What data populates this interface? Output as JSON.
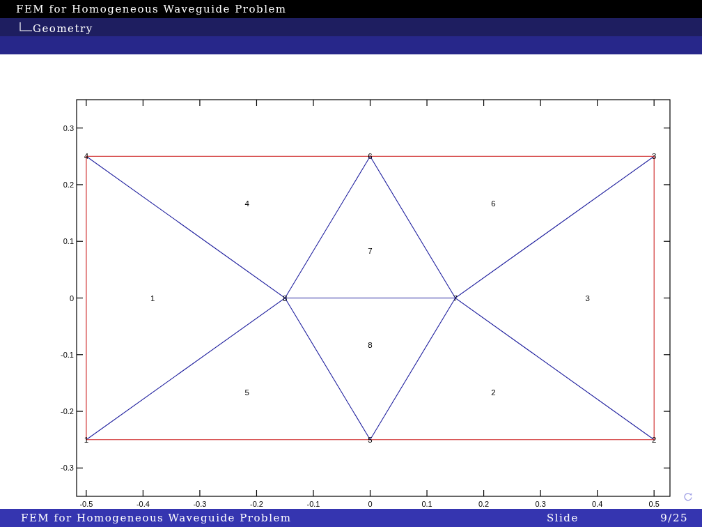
{
  "header": {
    "title": "FEM for Homogeneous Waveguide Problem",
    "section": "Geometry"
  },
  "figure": {
    "chart_data": {
      "type": "line",
      "xlim": [
        -0.517,
        0.528
      ],
      "ylim": [
        -0.35,
        0.35
      ],
      "xticks": [
        -0.5,
        -0.4,
        -0.3,
        -0.2,
        -0.1,
        0,
        0.1,
        0.2,
        0.3,
        0.4,
        0.5
      ],
      "yticks": [
        -0.3,
        -0.2,
        -0.1,
        0,
        0.1,
        0.2,
        0.3
      ],
      "series": [
        {
          "color": "#1f1f9e",
          "x": [
            -0.5,
            -0.15,
            0,
            0.15,
            0.5
          ],
          "values": [
            0.25,
            0,
            0.25,
            0,
            0.25
          ]
        },
        {
          "color": "#1f1f9e",
          "x": [
            -0.15,
            0.15
          ],
          "values": [
            0,
            0
          ]
        },
        {
          "color": "#1f1f9e",
          "x": [
            -0.5,
            -0.15,
            0,
            0.15,
            0.5
          ],
          "values": [
            -0.25,
            0,
            -0.25,
            0,
            -0.25
          ]
        },
        {
          "color": "#cc1f1f",
          "x": [
            -0.5,
            0.5
          ],
          "values": [
            0.25,
            0.25
          ]
        },
        {
          "color": "#cc1f1f",
          "x": [
            -0.5,
            -0.5
          ],
          "values": [
            -0.25,
            0.25
          ]
        },
        {
          "color": "#cc1f1f",
          "x": [
            0.5,
            0.5
          ],
          "values": [
            -0.25,
            0.25
          ]
        },
        {
          "color": "#cc1f1f",
          "x": [
            -0.5,
            0.5
          ],
          "values": [
            -0.25,
            -0.25
          ]
        }
      ],
      "annotations": [
        {
          "x": -0.5,
          "y": 0.25,
          "text": "4"
        },
        {
          "x": 0,
          "y": 0.25,
          "text": "6"
        },
        {
          "x": 0.5,
          "y": 0.25,
          "text": "3"
        },
        {
          "x": -0.15,
          "y": 0,
          "text": "8"
        },
        {
          "x": 0.15,
          "y": 0,
          "text": "7"
        },
        {
          "x": -0.5,
          "y": -0.25,
          "text": "1"
        },
        {
          "x": 0,
          "y": -0.25,
          "text": "5"
        },
        {
          "x": 0.5,
          "y": -0.25,
          "text": "2"
        }
      ]
    },
    "element_labels": [
      "4",
      "6",
      "7",
      "1",
      "3",
      "8",
      "5",
      "2"
    ]
  },
  "footer": {
    "title": "FEM for Homogeneous Waveguide Problem",
    "label": "Slide",
    "page": "9/25"
  }
}
